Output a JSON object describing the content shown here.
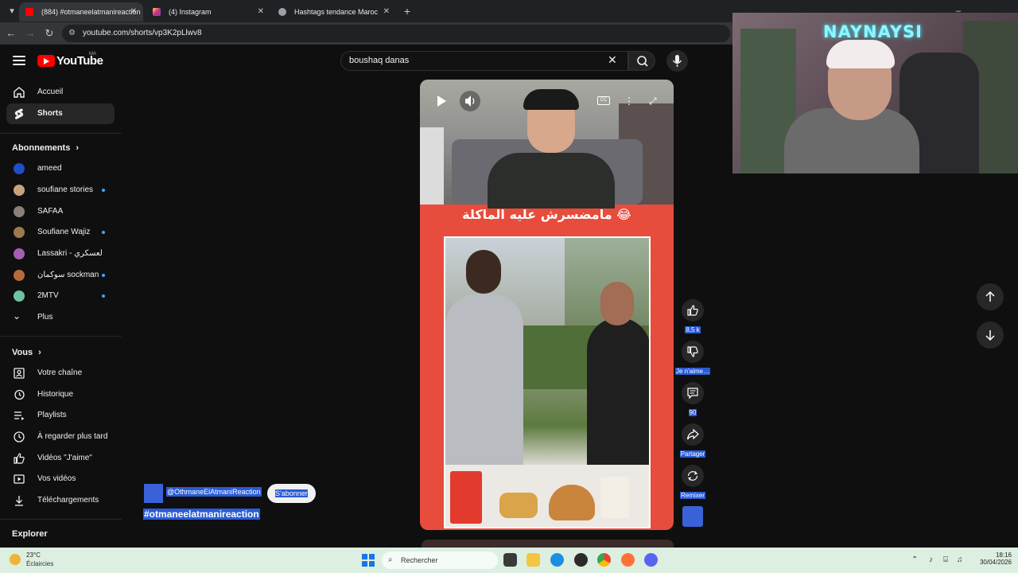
{
  "browser": {
    "tabs": [
      {
        "label": "(884) #otmaneelatmanireaction",
        "active": true
      },
      {
        "label": "(4) Instagram",
        "active": false
      },
      {
        "label": "Hashtags tendance Maroc",
        "active": false
      }
    ],
    "url": "youtube.com/shorts/vp3K2pLlwv8"
  },
  "header": {
    "logo_text": "YouTube",
    "country_code": "MA",
    "search_value": "boushaq danas"
  },
  "sidebar": {
    "main": [
      {
        "label": "Accueil",
        "icon": "home-icon"
      },
      {
        "label": "Shorts",
        "icon": "shorts-icon"
      }
    ],
    "subscriptions_heading": "Abonnements",
    "subscriptions": [
      {
        "label": "ameed",
        "avatar_color": "#1e4fc8",
        "live": false
      },
      {
        "label": "soufiane stories",
        "avatar_color": "#c9a27e",
        "live": true
      },
      {
        "label": "SAFAA",
        "avatar_color": "#8a7f7a",
        "live": false
      },
      {
        "label": "Soufiane Wajiz",
        "avatar_color": "#9b7a4e",
        "live": true
      },
      {
        "label": "Lassakri - لعسكري",
        "avatar_color": "#a55fb1",
        "live": false
      },
      {
        "label": "سوكمان sockman",
        "avatar_color": "#b86a3c",
        "live": true
      },
      {
        "label": "2MTV",
        "avatar_color": "#6fc3a2",
        "live": true
      }
    ],
    "more_label": "Plus",
    "you_heading": "Vous",
    "you_items": [
      {
        "label": "Votre chaîne",
        "icon": "channel-icon"
      },
      {
        "label": "Historique",
        "icon": "history-icon"
      },
      {
        "label": "Playlists",
        "icon": "playlists-icon"
      },
      {
        "label": "À regarder plus tard",
        "icon": "watch-later-icon"
      },
      {
        "label": "Vidéos \"J'aime\"",
        "icon": "like-icon"
      },
      {
        "label": "Vos vidéos",
        "icon": "your-videos-icon"
      },
      {
        "label": "Téléchargements",
        "icon": "download-icon"
      }
    ],
    "explore_heading": "Explorer"
  },
  "short": {
    "caption": "مامضسرش عليه الماكلة 😂",
    "channel": "@OthmaneElAtmaniReaction",
    "subscribe_label": "S'abonner",
    "hashtag": "#otmaneelatmanireaction",
    "actions": {
      "likes": "8,5 k",
      "dislike_label": "Je n'aime…",
      "comments": "90",
      "share_label": "Partager",
      "remix_label": "Remixer"
    },
    "cc_label": "CC"
  },
  "stream_overlay": {
    "name": "NAYNAYSI"
  },
  "taskbar": {
    "temperature": "23°C",
    "weather": "Éclaircies",
    "search_placeholder": "Rechercher",
    "time": "18:16",
    "date": "30/04/2026"
  },
  "colors": {
    "youtube_red": "#ff0000",
    "highlight": "#2a5bd7",
    "short_background": "#e74c3c",
    "live_dot": "#3ea6ff"
  }
}
